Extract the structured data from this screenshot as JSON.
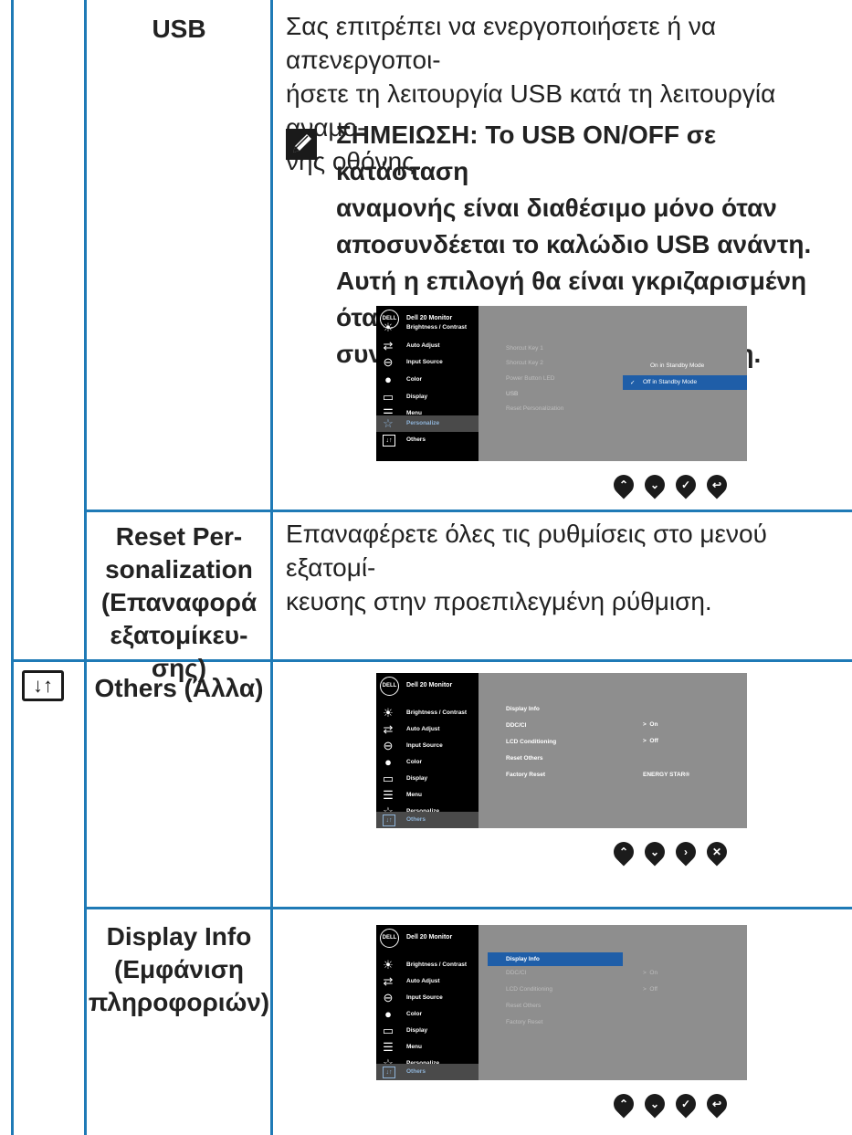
{
  "rows": {
    "usb": {
      "label": "USB",
      "desc_lines": [
        "Σας επιτρέπει να ενεργοποιήσετε ή να απενεργοποι-",
        "ήσετε τη λειτουργία USB κατά τη λειτουργία αναμο-",
        "νής οθόνης."
      ],
      "note_lines": [
        "ΣΗΜΕΙΩΣΗ: Το USB ON/OFF σε κατάσταση",
        "αναμονής είναι διαθέσιμο μόνο όταν",
        "αποσυνδέεται το καλώδιο USB ανάντη.",
        "Αυτή η επιλογή θα είναι γκριζαρισμένη όταν",
        "συνδέεται το καλώδιο USB ανάντη."
      ]
    },
    "reset": {
      "label_lines": [
        "Reset Per-",
        "sonalization",
        "(Επαναφορά",
        "εξατομίκευ-",
        "σης)"
      ],
      "desc_lines": [
        "Επαναφέρετε όλες τις ρυθμίσεις στο μενού εξατομί-",
        "κευσης στην προεπιλεγμένη ρύθμιση."
      ]
    },
    "others": {
      "label": "Others (Άλλα)",
      "icon": "others-icon"
    },
    "display_info": {
      "label_lines": [
        "Display Info",
        "(Εμφάνιση",
        "πληροφοριών)"
      ]
    }
  },
  "osd": {
    "logo": "DELL",
    "title": "Dell 20 Monitor",
    "menu": [
      "Brightness / Contrast",
      "Auto Adjust",
      "Input Source",
      "Color",
      "Display",
      "Menu",
      "Personalize",
      "Others"
    ],
    "personalize_items": [
      "Shorcut Key 1",
      "Shorcut Key 2",
      "Power Button LED",
      "USB",
      "Reset Personalization"
    ],
    "usb_options": [
      "On in Standby Mode",
      "Off in Standby Mode"
    ],
    "others_items": [
      "Display Info",
      "DDC/CI",
      "LCD Conditioning",
      "Reset Others",
      "Factory Reset"
    ],
    "others_values": {
      "ddc": "On",
      "lcd": "Off",
      "factory": "ENERGY STAR®"
    }
  },
  "colors": {
    "rule": "#1f7ab6",
    "osd_panel": "#8e8e8e",
    "osd_highlight": "#1f5ea8"
  }
}
